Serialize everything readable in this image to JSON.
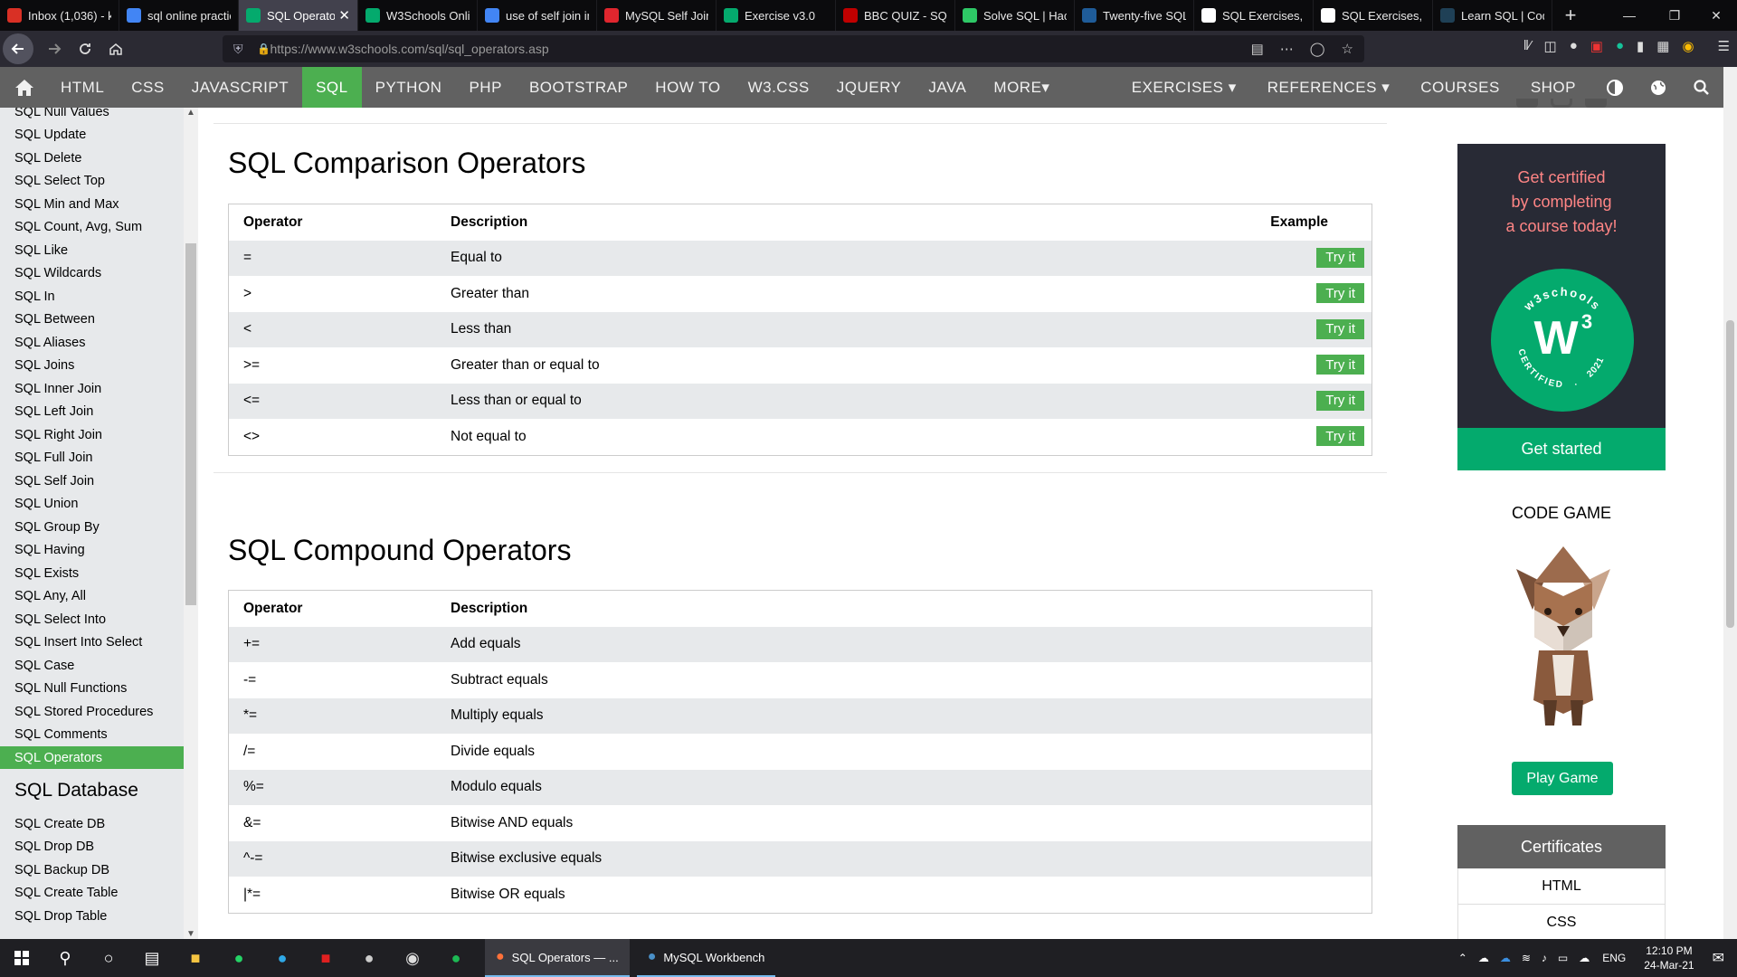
{
  "browser": {
    "tabs": [
      {
        "title": "Inbox (1,036) - k",
        "icon": "gmail-icon",
        "color": "#d93025"
      },
      {
        "title": "sql online practic",
        "icon": "google-icon",
        "color": "#4285f4"
      },
      {
        "title": "SQL Operato",
        "icon": "w3schools-icon",
        "color": "#04aa6d",
        "active": true
      },
      {
        "title": "W3Schools Onlin",
        "icon": "w3schools-icon",
        "color": "#04aa6d"
      },
      {
        "title": "use of self join in",
        "icon": "google-icon",
        "color": "#4285f4"
      },
      {
        "title": "MySQL Self Join",
        "icon": "mysqltutorial-icon",
        "color": "#e0262e"
      },
      {
        "title": "Exercise v3.0",
        "icon": "w3schools-icon",
        "color": "#04aa6d"
      },
      {
        "title": "BBC QUIZ - SQL",
        "icon": "bbc-icon",
        "color": "#c00000"
      },
      {
        "title": "Solve SQL | Hack",
        "icon": "hackerrank-icon",
        "color": "#2ec866"
      },
      {
        "title": "Twenty-five SQL",
        "icon": "site-icon",
        "color": "#1f5c99"
      },
      {
        "title": "SQL Exercises, Pr",
        "icon": "w3resource-icon",
        "color": "#ffffff"
      },
      {
        "title": "SQL Exercises, Pr",
        "icon": "w3resource-icon",
        "color": "#ffffff"
      },
      {
        "title": "Learn SQL | Code",
        "icon": "codecademy-icon",
        "color": "#1f4056"
      }
    ],
    "url": "https://www.w3schools.com/sql/sql_operators.asp"
  },
  "topnav": {
    "items": [
      "HTML",
      "CSS",
      "JAVASCRIPT",
      "SQL",
      "PYTHON",
      "PHP",
      "BOOTSTRAP",
      "HOW TO",
      "W3.CSS",
      "JQUERY",
      "JAVA",
      "MORE"
    ],
    "active": "SQL",
    "right": [
      "EXERCISES",
      "REFERENCES",
      "COURSES",
      "SHOP"
    ]
  },
  "sidebar": {
    "items": [
      "SQL Null Values",
      "SQL Update",
      "SQL Delete",
      "SQL Select Top",
      "SQL Min and Max",
      "SQL Count, Avg, Sum",
      "SQL Like",
      "SQL Wildcards",
      "SQL In",
      "SQL Between",
      "SQL Aliases",
      "SQL Joins",
      "SQL Inner Join",
      "SQL Left Join",
      "SQL Right Join",
      "SQL Full Join",
      "SQL Self Join",
      "SQL Union",
      "SQL Group By",
      "SQL Having",
      "SQL Exists",
      "SQL Any, All",
      "SQL Select Into",
      "SQL Insert Into Select",
      "SQL Case",
      "SQL Null Functions",
      "SQL Stored Procedures",
      "SQL Comments",
      "SQL Operators"
    ],
    "active": "SQL Operators",
    "section_heading": "SQL Database",
    "section_items": [
      "SQL Create DB",
      "SQL Drop DB",
      "SQL Backup DB",
      "SQL Create Table",
      "SQL Drop Table"
    ]
  },
  "main": {
    "comparison": {
      "title": "SQL Comparison Operators",
      "headers": [
        "Operator",
        "Description",
        "Example"
      ],
      "rows": [
        {
          "op": "=",
          "desc": "Equal to",
          "btn": "Try it"
        },
        {
          "op": ">",
          "desc": "Greater than",
          "btn": "Try it"
        },
        {
          "op": "<",
          "desc": "Less than",
          "btn": "Try it"
        },
        {
          "op": ">=",
          "desc": "Greater than or equal to",
          "btn": "Try it"
        },
        {
          "op": "<=",
          "desc": "Less than or equal to",
          "btn": "Try it"
        },
        {
          "op": "<>",
          "desc": "Not equal to",
          "btn": "Try it"
        }
      ]
    },
    "compound": {
      "title": "SQL Compound Operators",
      "headers": [
        "Operator",
        "Description"
      ],
      "rows": [
        {
          "op": "+=",
          "desc": "Add equals"
        },
        {
          "op": "-=",
          "desc": "Subtract equals"
        },
        {
          "op": "*=",
          "desc": "Multiply equals"
        },
        {
          "op": "/=",
          "desc": "Divide equals"
        },
        {
          "op": "%=",
          "desc": "Modulo equals"
        },
        {
          "op": "&=",
          "desc": "Bitwise AND equals"
        },
        {
          "op": "^-=",
          "desc": "Bitwise exclusive equals"
        },
        {
          "op": "|*=",
          "desc": "Bitwise OR equals"
        }
      ]
    }
  },
  "rightcol": {
    "cert_text": [
      "Get certified",
      "by completing",
      "a course today!"
    ],
    "badge_brand": "w3schools",
    "badge_mark": "W",
    "badge_sup": "3",
    "badge_word": "CERTIFIED",
    "badge_dot": ".",
    "badge_year": "2021",
    "get_started": "Get started",
    "code_game": "CODE GAME",
    "play_game": "Play Game",
    "certificates": "Certificates",
    "cert_items": [
      "HTML",
      "CSS"
    ]
  },
  "taskbar": {
    "apps": [
      {
        "label": "SQL Operators — ...",
        "icon": "firefox-icon",
        "active": true
      },
      {
        "label": "MySQL Workbench",
        "icon": "mysql-workbench-icon",
        "active": false
      }
    ],
    "lang": "ENG",
    "time": "12:10 PM",
    "date": "24-Mar-21"
  },
  "colors": {
    "accent_green": "#4caf50",
    "w3_green": "#04aa6d",
    "topnav_bg": "#616161",
    "cert_card_bg": "#282a35",
    "cert_text": "#ff8585"
  }
}
